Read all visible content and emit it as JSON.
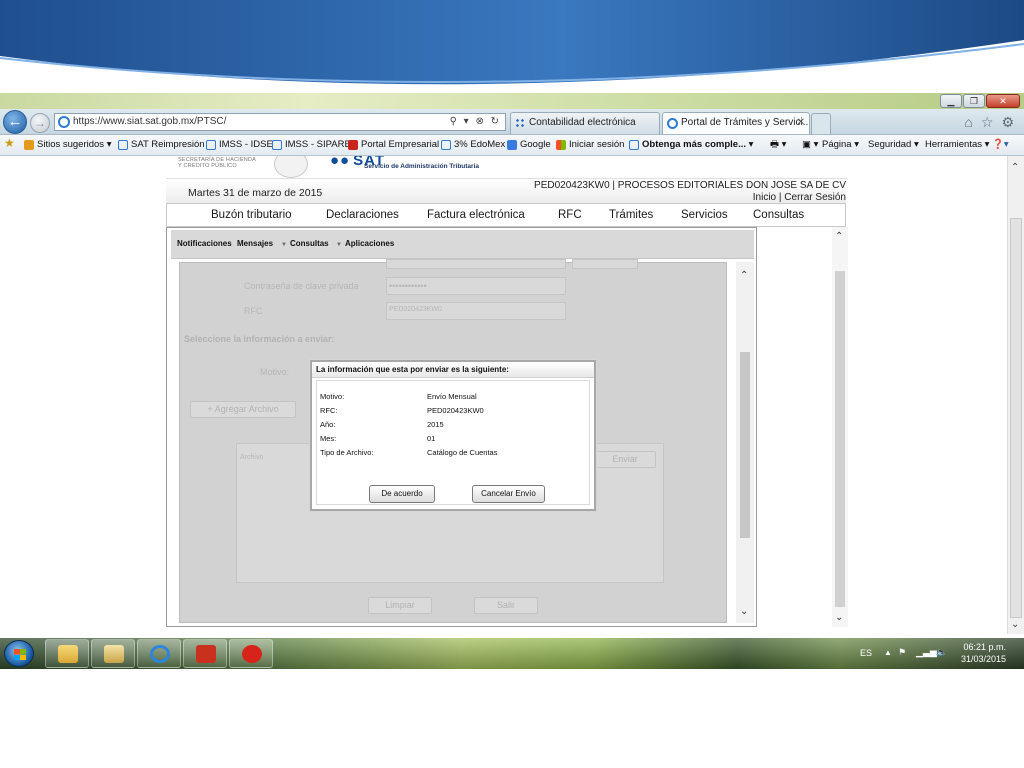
{
  "browser": {
    "address_url": "https://www.siat.sat.gob.mx/PTSC/",
    "tabs": [
      {
        "label": "Contabilidad electrónica"
      },
      {
        "label": "Portal de Trámites y Servici..."
      }
    ],
    "favorites": [
      {
        "label": "Sitios sugeridos ▾"
      },
      {
        "label": "SAT Reimpresión"
      },
      {
        "label": "IMSS - IDSE"
      },
      {
        "label": "IMSS - SIPARE"
      },
      {
        "label": "Portal Empresarial"
      },
      {
        "label": "3% EdoMex"
      },
      {
        "label": "Google"
      },
      {
        "label": "Iniciar sesión"
      },
      {
        "label": "Obtenga más comple..."
      }
    ],
    "commands": {
      "page": "Página ▾",
      "security": "Seguridad ▾",
      "tools": "Herramientas ▾"
    }
  },
  "sat": {
    "shcp_line1": "SECRETARÍA DE HACIENDA",
    "shcp_line2": "Y CRÉDITO PÚBLICO",
    "logo": "SAT",
    "subtitle": "Servicio de Administración Tributaria",
    "date": "Martes 31 de marzo de 2015",
    "user": "PED020423KW0 | PROCESOS EDITORIALES DON JOSE SA DE CV",
    "links": {
      "home": "Inicio",
      "separator": "|",
      "logout": "Cerrar Sesión"
    },
    "main_menu": [
      "Buzón tributario",
      "Declaraciones",
      "Factura electrónica",
      "RFC",
      "Trámites",
      "Servicios",
      "Consultas"
    ],
    "sub_menu": {
      "notifications": "Notificaciones",
      "messages": "Mensajes",
      "queries": "Consultas",
      "apps": "Aplicaciones"
    }
  },
  "form_bg": {
    "password_label": "Contraseña de clave privada",
    "password_value": "••••••••••••",
    "rfc_label": "RFC",
    "rfc_value": "PED020423KW0",
    "select_label": "Seleccione la información a enviar:",
    "motive_label": "Motivo:",
    "add_file": "+ Agregar Archivo",
    "file_header": "Archivo",
    "send": "Enviar",
    "clear": "Limpiar",
    "exit": "Salir"
  },
  "dialog": {
    "title": "La información que esta por enviar es la siguiente:",
    "rows": [
      {
        "label": "Motivo:",
        "value": "Envío Mensual"
      },
      {
        "label": "RFC:",
        "value": "PED020423KW0"
      },
      {
        "label": "Año:",
        "value": "2015"
      },
      {
        "label": "Mes:",
        "value": "01"
      },
      {
        "label": "Tipo de Archivo:",
        "value": "Catálogo de Cuentas"
      }
    ],
    "accept": "De acuerdo",
    "cancel": "Cancelar Envío"
  },
  "taskbar": {
    "lang": "ES",
    "time": "06:21 p.m.",
    "date": "31/03/2015"
  },
  "colors": {
    "sat_blue": "#0d4c96",
    "ie_blue": "#1d5aa3",
    "panel_gray": "#d2d2d2"
  }
}
